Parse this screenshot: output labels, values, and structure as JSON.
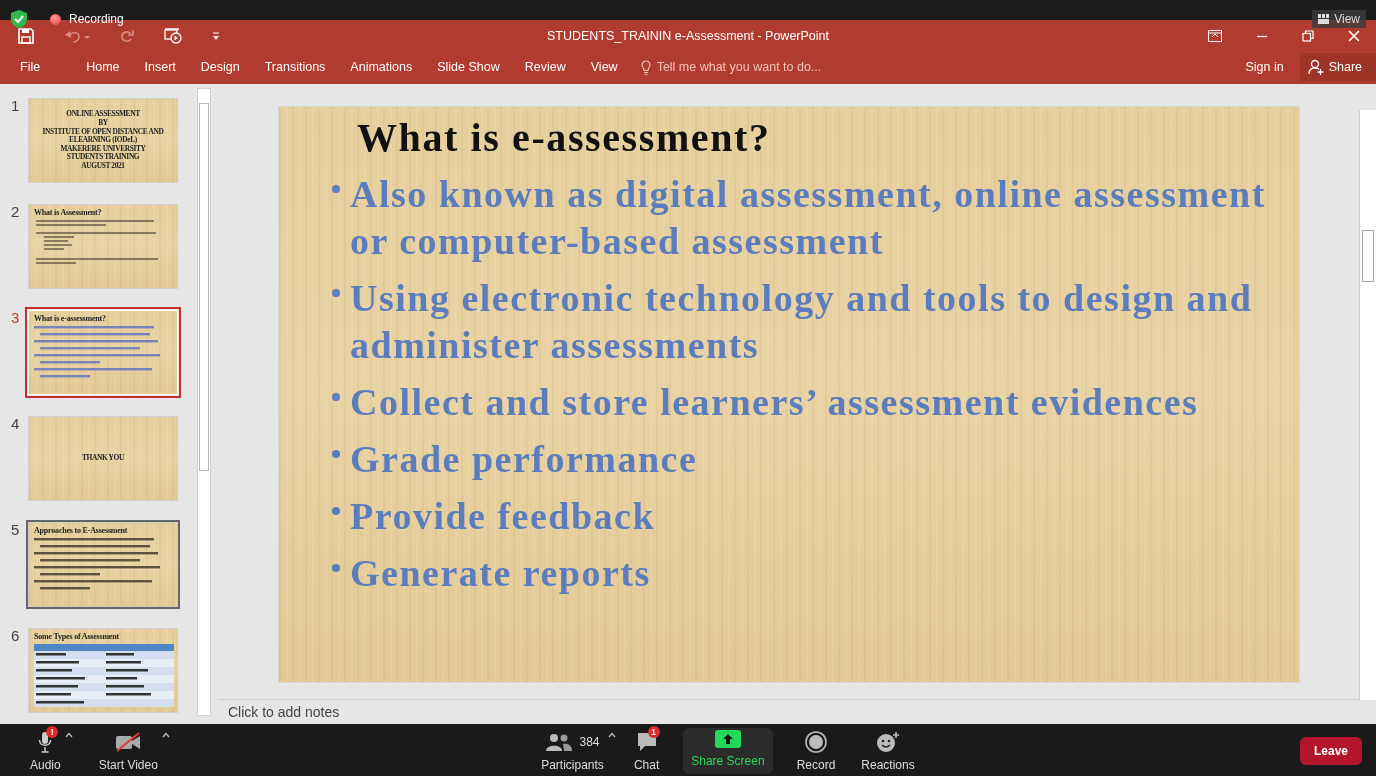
{
  "recording": {
    "label": "Recording"
  },
  "view_button": {
    "label": "View"
  },
  "window": {
    "title": "STUDENTS_TRAININ e-Assessment - PowerPoint"
  },
  "ribbon": {
    "tabs": [
      {
        "label": "File",
        "selected": false
      },
      {
        "label": "Home",
        "selected": false
      },
      {
        "label": "Insert",
        "selected": false
      },
      {
        "label": "Design",
        "selected": false
      },
      {
        "label": "Transitions",
        "selected": false
      },
      {
        "label": "Animations",
        "selected": false
      },
      {
        "label": "Slide Show",
        "selected": false
      },
      {
        "label": "Review",
        "selected": false
      },
      {
        "label": "View",
        "selected": false
      }
    ],
    "tell_me": {
      "placeholder": "Tell me what you want to do..."
    },
    "sign_in": "Sign in",
    "share": "Share"
  },
  "thumbnails": [
    {
      "number": "1",
      "selected": false,
      "hovered": false,
      "kind": "centered",
      "lines": [
        "ONLINE ASSESSMENT",
        "BY",
        "INSTITUTE OF OPEN DISTANCE AND",
        "ELEARNING (IODeL)",
        "MAKERERE UNIVERSITY",
        "STUDENTS TRAINING",
        "AUGUST 2021"
      ]
    },
    {
      "number": "2",
      "selected": false,
      "hovered": false,
      "kind": "sketch",
      "title": "What is Assessment?"
    },
    {
      "number": "3",
      "selected": true,
      "hovered": false,
      "kind": "bullets",
      "title": "What is e-assessment?"
    },
    {
      "number": "4",
      "selected": false,
      "hovered": false,
      "kind": "centered",
      "lines": [
        "THANK YOU"
      ]
    },
    {
      "number": "5",
      "selected": false,
      "hovered": true,
      "kind": "bullets",
      "title": "Approaches to E-Assessment"
    },
    {
      "number": "6",
      "selected": false,
      "hovered": false,
      "kind": "table",
      "title": "Some Types of Assessment"
    }
  ],
  "slide": {
    "title": "What is e-assessment?",
    "bullets": [
      {
        "text": "Also known as digital assessment, online assessment or computer-based assessment"
      },
      {
        "text": "Using electronic technology and tools to design and administer assessments"
      },
      {
        "text": "Collect and store learners’ assessment evidences"
      },
      {
        "text": "Grade performance"
      },
      {
        "text": "Provide feedback"
      },
      {
        "text": "Generate reports"
      }
    ]
  },
  "notes": {
    "placeholder": "Click to add notes"
  },
  "meeting_bar": {
    "items": [
      {
        "kind": "audio",
        "label": "Audio",
        "badge": "!"
      },
      {
        "kind": "video",
        "label": "Start Video"
      },
      {
        "kind": "participants",
        "label": "Participants",
        "count": "384"
      },
      {
        "kind": "chat",
        "label": "Chat",
        "badge": "1"
      },
      {
        "kind": "share",
        "label": "Share Screen"
      },
      {
        "kind": "record",
        "label": "Record"
      },
      {
        "kind": "reactions",
        "label": "Reactions"
      }
    ],
    "leave": "Leave"
  }
}
